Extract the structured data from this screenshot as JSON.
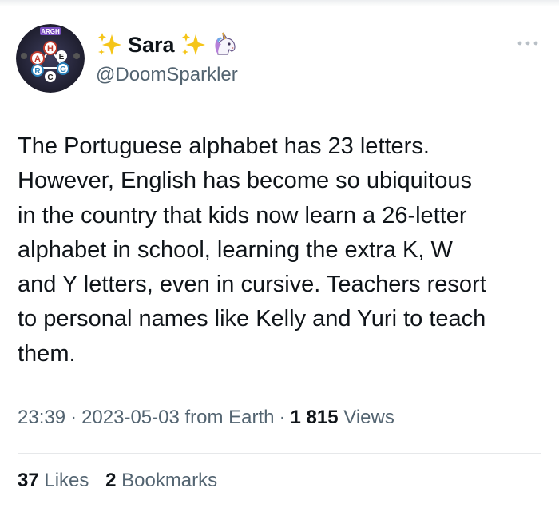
{
  "author": {
    "display_name": "Sara",
    "handle": "@DoomSparkler",
    "avatar_icon": "argh-game-avatar",
    "avatar_text": "ARGH",
    "avatar_letters": [
      "H",
      "E",
      "A",
      "G",
      "R",
      "C"
    ]
  },
  "tweet": {
    "text": "The Portuguese alphabet has 23 letters.\nHowever, English has become so ubiquitous\nin the country that kids now learn a 26-letter\nalphabet in school, learning the extra K, W\nand Y letters, even in cursive. Teachers resort\nto personal names like Kelly and Yuri to teach\nthem."
  },
  "meta": {
    "time": "23:39",
    "separator": "·",
    "date": "2023-05-03",
    "source": "from Earth",
    "views_count": "1 815",
    "views_label": "Views"
  },
  "engagement": {
    "likes_count": "37",
    "likes_label": "Likes",
    "bookmarks_count": "2",
    "bookmarks_label": "Bookmarks"
  },
  "icons": {
    "sparkle": "sparkles-icon",
    "unicorn": "unicorn-icon",
    "more": "more-horizontal-icon"
  },
  "colors": {
    "text_primary": "#0f1419",
    "text_secondary": "#536471",
    "divider": "#e6e8ea",
    "sparkle_yellow": "#f5c518",
    "avatar_bg": "#2a2a3e"
  }
}
